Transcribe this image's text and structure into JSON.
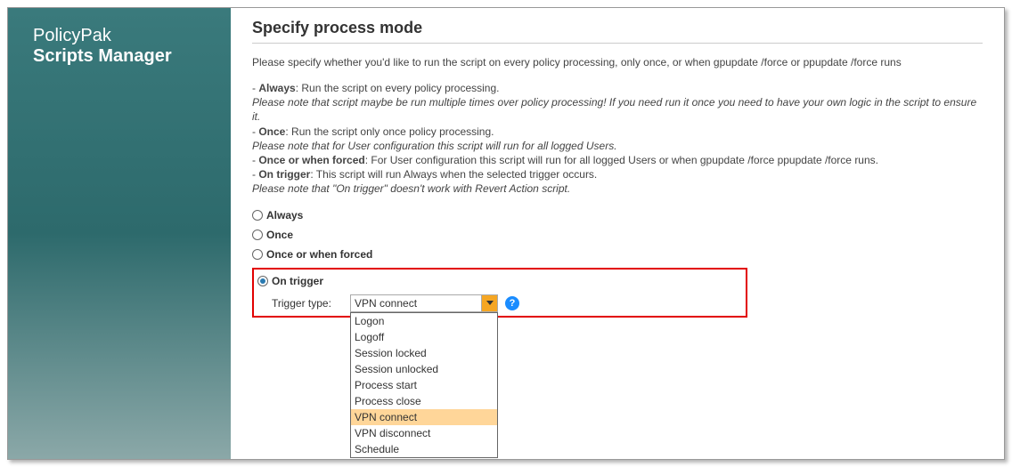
{
  "sidebar": {
    "line1": "PolicyPak",
    "line2": "Scripts Manager"
  },
  "title": "Specify process mode",
  "intro": "Please specify whether you'd like to run the script on every policy processing, only once, or when gpupdate /force or ppupdate /force runs",
  "desc": {
    "always_lead": "- ",
    "always_b": "Always",
    "always_tail": ": Run the script on every policy processing.",
    "always_note": "Please note that script maybe be run multiple times over policy processing! If you need run it once you need to have your own logic in the script to ensure it.",
    "once_lead": "- ",
    "once_b": "Once",
    "once_tail": ": Run the script only once policy processing.",
    "once_note": "Please note that for User configuration this script will run for all logged Users.",
    "forced_lead": "- ",
    "forced_b": "Once or when forced",
    "forced_tail": ": For User configuration this script will run for all logged Users or when gpupdate /force ppupdate /force runs.",
    "trigger_lead": "- ",
    "trigger_b": "On trigger",
    "trigger_tail": ": This script will run Always when the selected trigger occurs.",
    "trigger_note": "Please note that \"On trigger\" doesn't work with Revert Action script."
  },
  "options": {
    "always": "Always",
    "once": "Once",
    "forced": "Once or when forced",
    "trigger": "On trigger"
  },
  "trigger_label": "Trigger type:",
  "dropdown": {
    "selected": "VPN connect",
    "items": [
      "Logon",
      "Logoff",
      "Session locked",
      "Session unlocked",
      "Process start",
      "Process close",
      "VPN connect",
      "VPN disconnect",
      "Schedule"
    ]
  },
  "help_glyph": "?"
}
